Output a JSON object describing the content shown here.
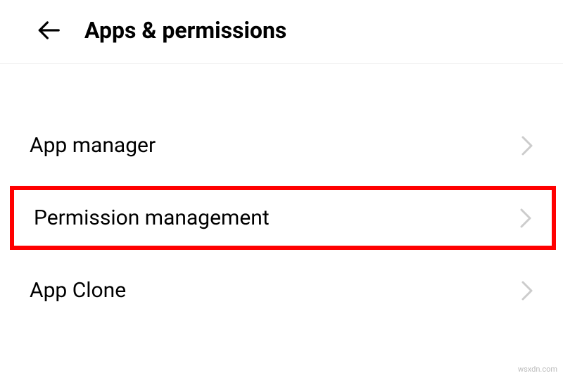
{
  "header": {
    "title": "Apps & permissions"
  },
  "items": [
    {
      "label": "App manager"
    },
    {
      "label": "Permission management"
    },
    {
      "label": "App Clone"
    }
  ],
  "watermark": "wsxdn.com"
}
